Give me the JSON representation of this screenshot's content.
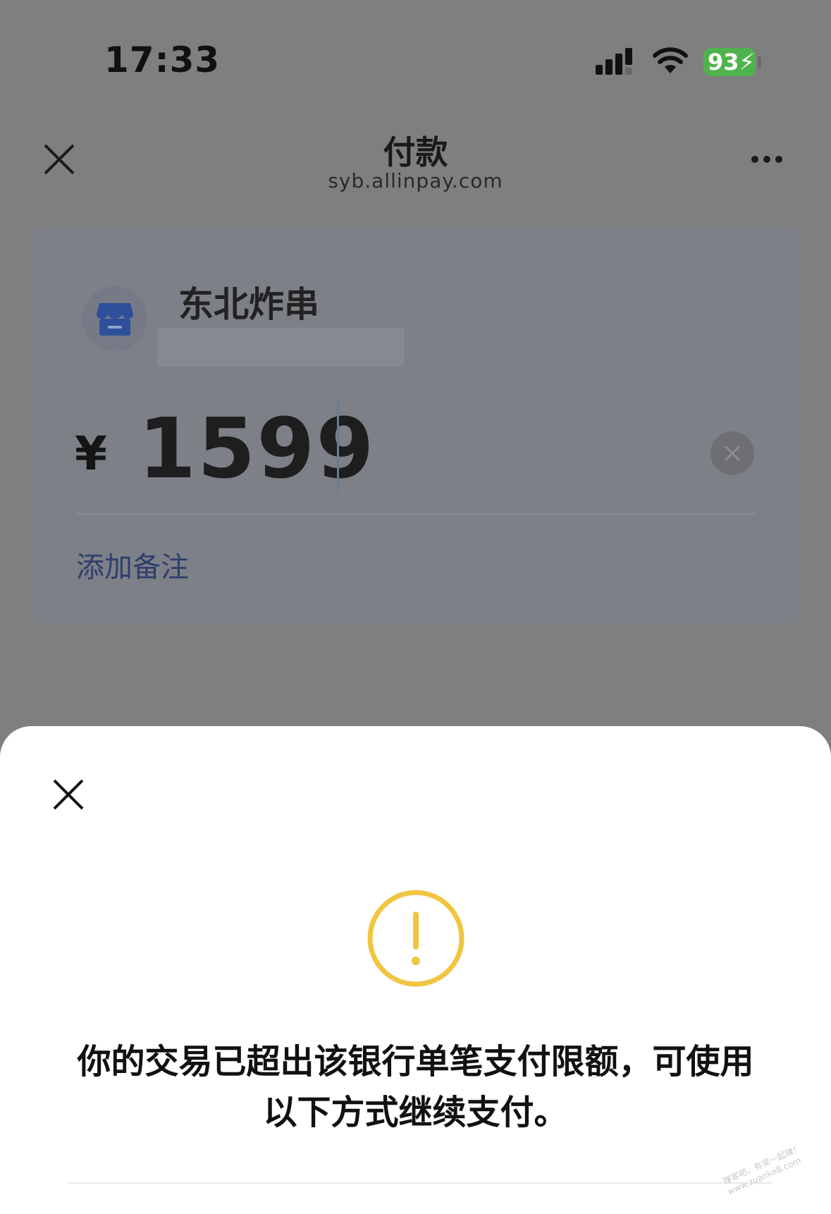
{
  "status_bar": {
    "time": "17:33",
    "battery_level": "93"
  },
  "nav": {
    "title": "付款",
    "subtitle": "syb.allinpay.com"
  },
  "payment_card": {
    "merchant_name": "东北炸串",
    "currency_symbol": "¥",
    "amount": "1599",
    "add_note_label": "添加备注"
  },
  "sheet": {
    "message_line1": "你的交易已超出该银行单笔支付限额，可使用",
    "message_line2": "以下方式继续支付。",
    "warning_color": "#f0c540"
  },
  "watermark": {
    "line1": "赚客吧，有奖一起赚！",
    "line2": "www.zuanke8.com"
  }
}
